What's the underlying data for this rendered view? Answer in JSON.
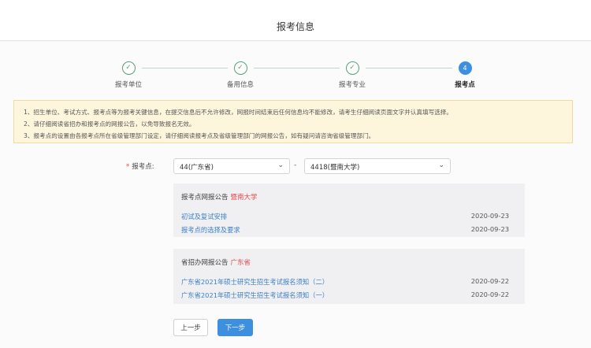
{
  "header": {
    "title": "报考信息"
  },
  "stepper": {
    "steps": [
      {
        "label": "报考单位",
        "state": "done",
        "icon": "check-icon"
      },
      {
        "label": "备用信息",
        "state": "done",
        "icon": "check-icon"
      },
      {
        "label": "报考专业",
        "state": "done",
        "icon": "check-icon"
      },
      {
        "label": "报考点",
        "state": "active",
        "number": "4"
      }
    ]
  },
  "notice": {
    "lines": [
      "1、招生单位、考试方式、报考点等为报考关键信息，在提交信息后不允许修改，网报时间结束后任何信息均不能修改，请考生仔细阅读页面文字并认真填写选择。",
      "2、请仔细阅读省招办和报考点的网报公告，以免导致报名无效。",
      "3、报考点的设置由各报考点所在省级管理部门设定，请仔细阅读报考点及省级管理部门的网报公告，如有疑问请咨询省级管理部门。"
    ]
  },
  "form": {
    "required_mark": "*",
    "label": "报考点:",
    "province_value": "44(广东省)",
    "separator": "-",
    "site_value": "4418(暨南大学)"
  },
  "site_panel": {
    "title": "报考点网报公告",
    "highlight": "暨南大学",
    "items": [
      {
        "text": "初试及复试安排",
        "date": "2020-09-23"
      },
      {
        "text": "报考点的选择及要求",
        "date": "2020-09-23"
      }
    ]
  },
  "province_panel": {
    "title": "省招办网报公告",
    "highlight": "广东省",
    "items": [
      {
        "text": "广东省2021年硕士研究生招生考试报名须知（二）",
        "date": "2020-09-22"
      },
      {
        "text": "广东省2021年硕士研究生招生考试报名须知（一）",
        "date": "2020-09-22"
      }
    ]
  },
  "buttons": {
    "prev": "上一步",
    "next": "下一步"
  },
  "colors": {
    "primary": "#3d8fe0",
    "done": "#52a17a",
    "required": "#e24c4c",
    "notice_bg": "#fdf6dd"
  }
}
